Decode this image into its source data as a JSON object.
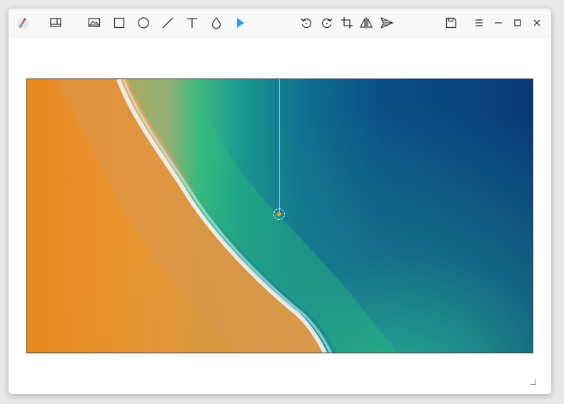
{
  "app": {
    "icon": "paintbrush-app-icon"
  },
  "toolbar": {
    "left": [
      {
        "name": "app-icon",
        "icon": "paintbrush-icon"
      },
      {
        "name": "sidebar-toggle-button",
        "icon": "panel-icon"
      },
      {
        "name": "image-tool-button",
        "icon": "image-icon"
      },
      {
        "name": "rectangle-tool-button",
        "icon": "rectangle-icon"
      },
      {
        "name": "ellipse-tool-button",
        "icon": "ellipse-icon"
      },
      {
        "name": "line-tool-button",
        "icon": "line-icon"
      },
      {
        "name": "text-tool-button",
        "icon": "text-icon"
      },
      {
        "name": "blur-tool-button",
        "icon": "droplet-icon"
      },
      {
        "name": "select-tool-button",
        "icon": "pointer-icon",
        "active": true
      }
    ],
    "middle": [
      {
        "name": "rotate-left-button",
        "icon": "rotate-ccw-icon"
      },
      {
        "name": "rotate-right-button",
        "icon": "rotate-cw-icon"
      },
      {
        "name": "crop-button",
        "icon": "crop-icon"
      },
      {
        "name": "flip-button",
        "icon": "flip-icon"
      },
      {
        "name": "send-button",
        "icon": "send-icon"
      }
    ],
    "right": [
      {
        "name": "save-button",
        "icon": "save-icon"
      },
      {
        "name": "menu-button",
        "icon": "hamburger-icon"
      },
      {
        "name": "minimize-button",
        "icon": "minimize-icon"
      },
      {
        "name": "maximize-button",
        "icon": "maximize-icon"
      },
      {
        "name": "close-button",
        "icon": "close-icon"
      }
    ]
  },
  "colors": {
    "accent": "#2f9bf0",
    "handle_line": "#6fc3ff",
    "handle_dot": "#f4a334"
  },
  "canvas": {
    "image_subject": "aerial-beach-wave"
  }
}
